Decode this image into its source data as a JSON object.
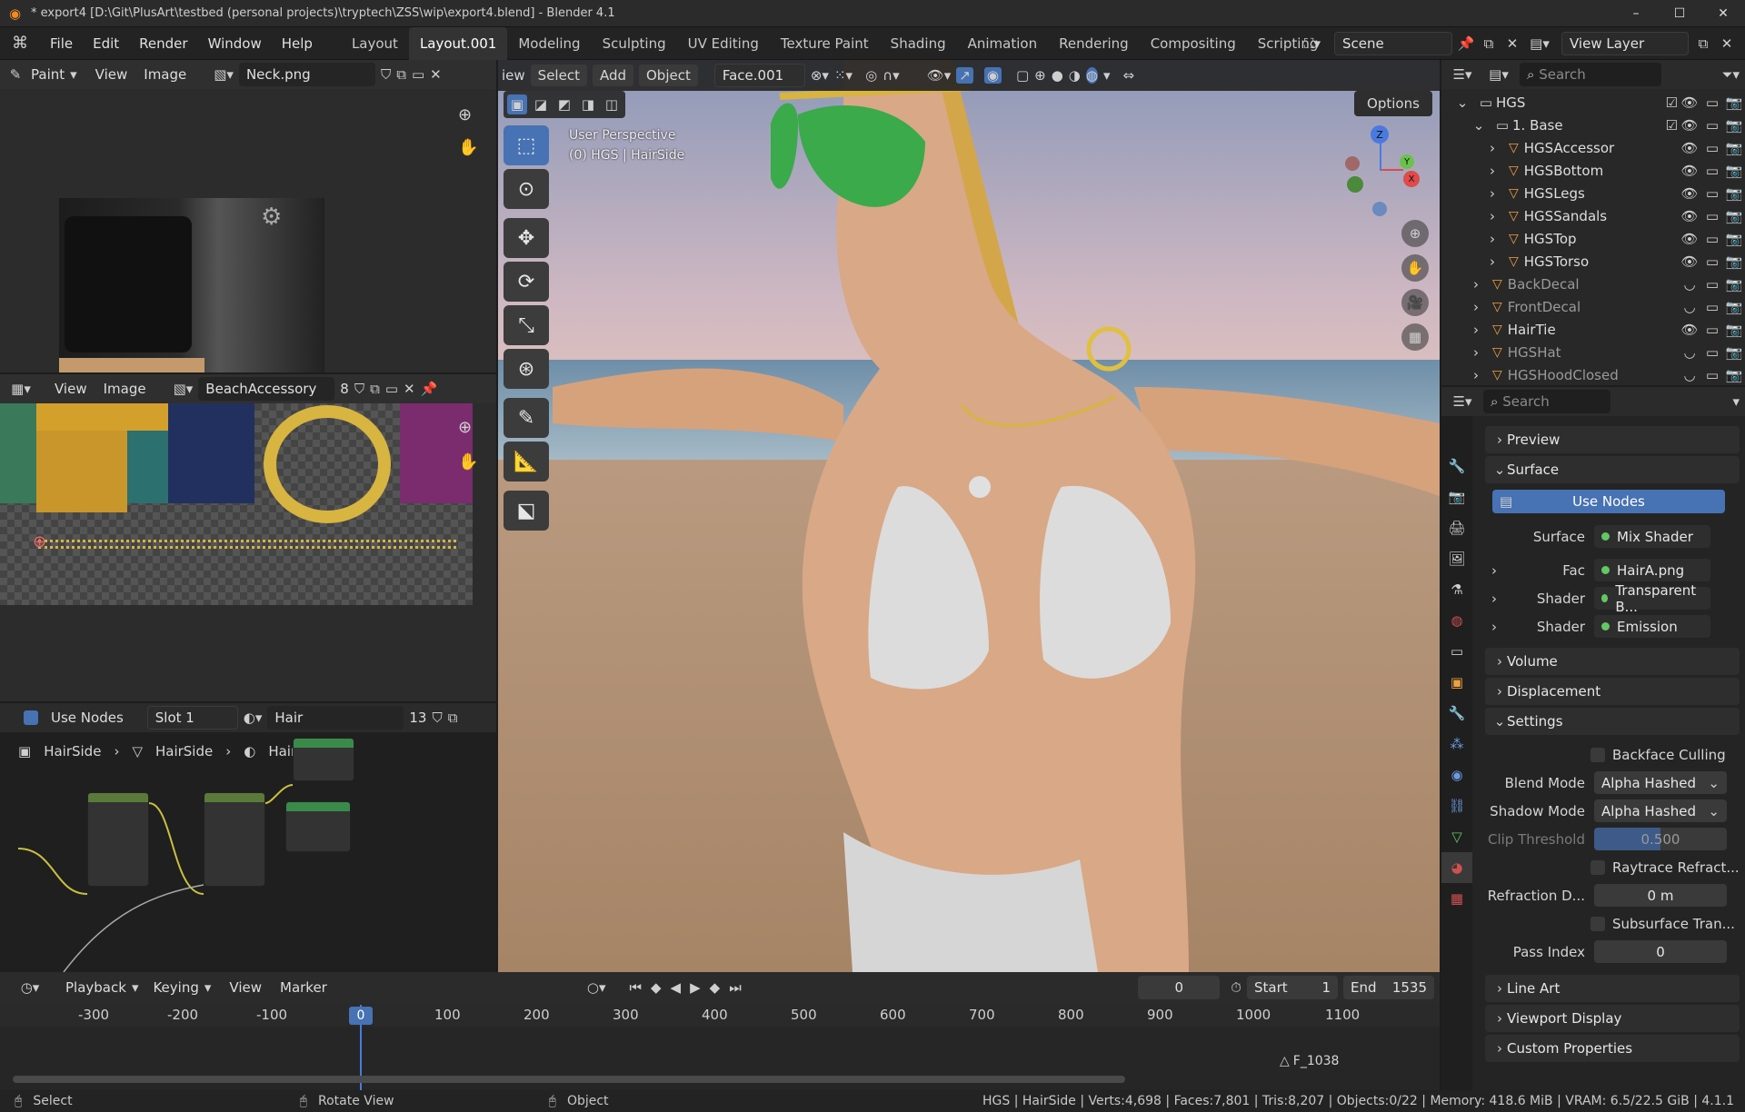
{
  "title_bar": {
    "title": "* export4 [D:\\Git\\PlusArt\\testbed (personal projects)\\tryptech\\ZSS\\wip\\export4.blend] - Blender 4.1",
    "minimize": "–",
    "maximize": "☐",
    "close": "✕"
  },
  "menubar": {
    "menus": [
      "File",
      "Edit",
      "Render",
      "Window",
      "Help"
    ],
    "workspaces": [
      "Layout",
      "Layout.001",
      "Modeling",
      "Sculpting",
      "UV Editing",
      "Texture Paint",
      "Shading",
      "Animation",
      "Rendering",
      "Compositing",
      "Scripting"
    ],
    "active_workspace": "Layout.001",
    "add_workspace": "+",
    "scene": "Scene",
    "view_layer": "View Layer"
  },
  "image_editor_top": {
    "mode": "Paint",
    "menus": [
      "View",
      "Image"
    ],
    "image_name": "Neck.png"
  },
  "image_editor_mid": {
    "menus": [
      "View",
      "Image"
    ],
    "image_name": "BeachAccessory",
    "users": "8"
  },
  "node_editor": {
    "use_nodes_label": "Use Nodes",
    "slot": "Slot 1",
    "material": "Hair",
    "users": "13",
    "breadcrumb": [
      "HairSide",
      "HairSide",
      "Hair"
    ]
  },
  "viewport": {
    "header_menus": [
      "iew",
      "Select",
      "Add",
      "Object"
    ],
    "uv_map": "Face.001",
    "options_label": "Options",
    "overlay_line1": "User Perspective",
    "overlay_line2": "(0) HGS | HairSide",
    "gizmo_axes": [
      "Z",
      "Y",
      "X"
    ]
  },
  "outliner": {
    "search_placeholder": "Search",
    "root": "HGS",
    "collection": "1. Base",
    "items": [
      {
        "name": "HGSAccessor",
        "dim": false
      },
      {
        "name": "HGSBottom",
        "dim": false
      },
      {
        "name": "HGSLegs",
        "dim": false
      },
      {
        "name": "HGSSandals",
        "dim": false
      },
      {
        "name": "HGSTop",
        "dim": false
      },
      {
        "name": "HGSTorso",
        "dim": false
      }
    ],
    "top_items": [
      {
        "name": "BackDecal",
        "dim": true
      },
      {
        "name": "FrontDecal",
        "dim": true
      },
      {
        "name": "HairTie",
        "dim": false
      },
      {
        "name": "HGSHat",
        "dim": true
      },
      {
        "name": "HGSHoodClosed",
        "dim": true
      }
    ]
  },
  "properties": {
    "search_placeholder": "Search",
    "sections": {
      "preview": "Preview",
      "surface": "Surface",
      "volume": "Volume",
      "displacement": "Displacement",
      "settings": "Settings",
      "line_art": "Line Art",
      "viewport_display": "Viewport Display",
      "custom_properties": "Custom Properties"
    },
    "use_nodes_button": "Use Nodes",
    "surface_label": "Surface",
    "surface_value": "Mix Shader",
    "fac_label": "Fac",
    "fac_value": "HairA.png",
    "shader1_label": "Shader",
    "shader1_value": "Transparent B...",
    "shader2_label": "Shader",
    "shader2_value": "Emission",
    "backface_culling": "Backface Culling",
    "blend_mode_label": "Blend Mode",
    "blend_mode_value": "Alpha Hashed",
    "shadow_mode_label": "Shadow Mode",
    "shadow_mode_value": "Alpha Hashed",
    "clip_threshold_label": "Clip Threshold",
    "clip_threshold_value": "0.500",
    "raytrace_refraction": "Raytrace Refract...",
    "refraction_depth_label": "Refraction D...",
    "refraction_depth_value": "0 m",
    "subsurface": "Subsurface Tran...",
    "pass_index_label": "Pass Index",
    "pass_index_value": "0"
  },
  "timeline": {
    "menus": [
      "Playback",
      "Keying",
      "View",
      "Marker"
    ],
    "current_frame": "0",
    "start_label": "Start",
    "start_value": "1",
    "end_label": "End",
    "end_value": "1535",
    "ticks": [
      "-300",
      "-200",
      "-100",
      "0",
      "100",
      "200",
      "300",
      "400",
      "500",
      "600",
      "700",
      "800",
      "900",
      "1000",
      "1100"
    ],
    "marker": "F_1038"
  },
  "statusbar": {
    "left": [
      "Select",
      "Rotate View",
      "Object"
    ],
    "info": "HGS | HairSide | Verts:4,698 | Faces:7,801 | Tris:8,207 | Objects:0/22 | Memory: 418.6 MiB | VRAM: 6.5/22.5 GiB | 4.1.1"
  },
  "colors": {
    "accent_blue": "#4772b3",
    "socket_green": "#63c763",
    "object_orange": "#f0a040"
  }
}
